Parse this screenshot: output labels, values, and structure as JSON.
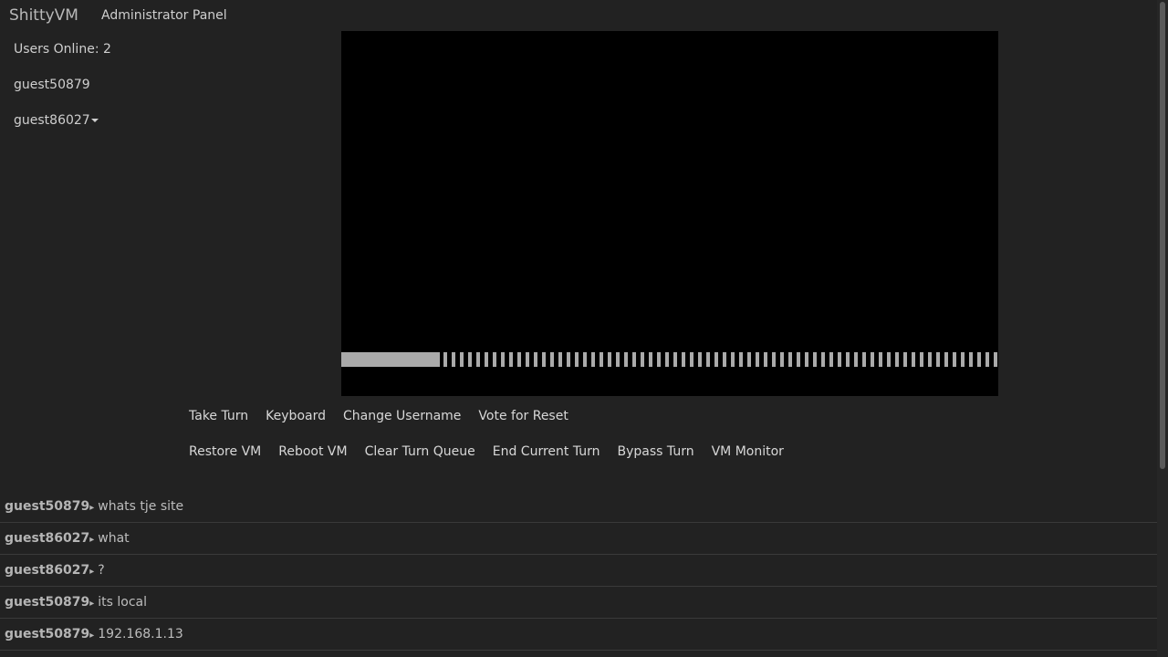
{
  "navbar": {
    "brand": "ShittyVM",
    "admin_link": "Administrator Panel"
  },
  "users": {
    "count_label": "Users Online: 2",
    "list": [
      {
        "name": "guest50879"
      },
      {
        "name": "guest86027",
        "has_menu": true
      }
    ]
  },
  "vm": {
    "screen_color": "#000000",
    "progress_fill_fraction": 0.15,
    "progress_color": "#aaaaaa"
  },
  "controls": {
    "row1": [
      "Take Turn",
      "Keyboard",
      "Change Username",
      "Vote for Reset"
    ],
    "row2": [
      "Restore VM",
      "Reboot VM",
      "Clear Turn Queue",
      "End Current Turn",
      "Bypass Turn",
      "VM Monitor"
    ]
  },
  "chat": {
    "separator": "▸",
    "messages": [
      {
        "user": "guest50879",
        "text": "whats tje site"
      },
      {
        "user": "guest86027",
        "text": "what"
      },
      {
        "user": "guest86027",
        "text": "?"
      },
      {
        "user": "guest50879",
        "text": "its local"
      },
      {
        "user": "guest50879",
        "text": "192.168.1.13"
      }
    ]
  },
  "theme": {
    "background": "#222222",
    "text": "#cfcfcf",
    "divider": "#3a3a3a"
  }
}
